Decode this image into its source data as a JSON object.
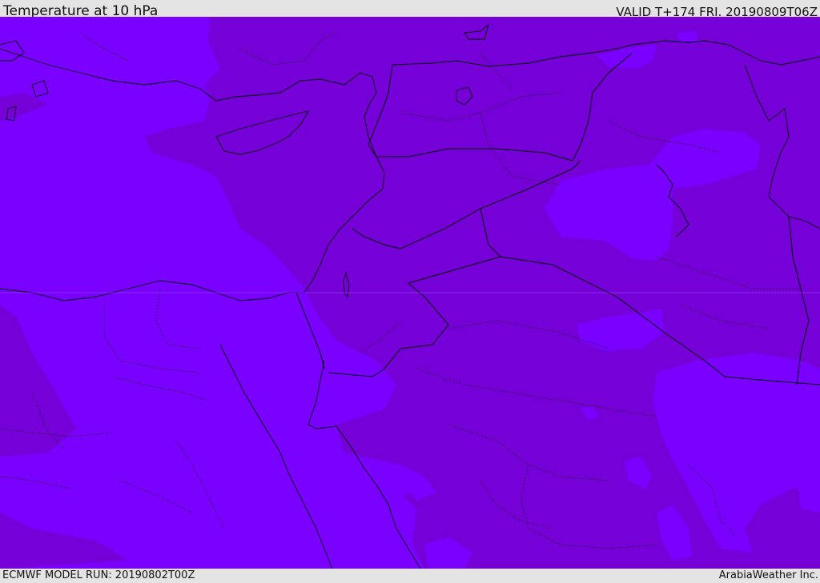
{
  "header": {
    "title": "Temperature at 10 hPa",
    "valid_time": "VALID T+174 FRI. 20190809T06Z"
  },
  "map": {
    "field": "temperature",
    "level": "10 hPa",
    "region": "Eastern Mediterranean / Middle East",
    "colors": {
      "background_band": "#7a00ff",
      "warmer_band": "#7600d8",
      "coastline": "#000000",
      "border": "#000000",
      "internal_boundary": "#222222"
    }
  },
  "footer": {
    "model_run": "ECMWF MODEL RUN: 20190802T00Z",
    "credit": "ArabiaWeather Inc."
  }
}
